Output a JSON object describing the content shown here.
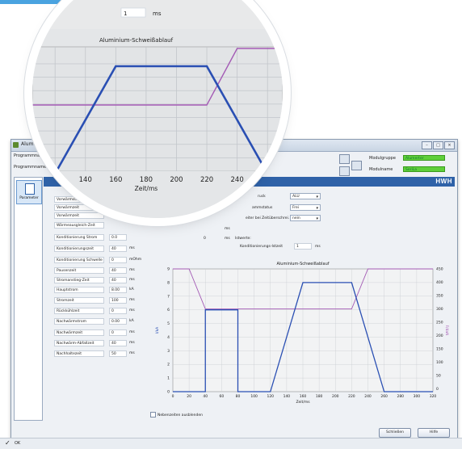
{
  "window": {
    "title": "Alumin",
    "row1_label": "Programmna",
    "row2_label": "Programmname",
    "modulgruppe_label": "Modulgruppe",
    "modulgruppe_value": "Alumerter",
    "modulname_label": "Modulname",
    "modulname_value": "SeriLa",
    "brand": "HWH"
  },
  "sidebar": {
    "items": [
      {
        "label": "Parameter"
      }
    ]
  },
  "params": [
    {
      "label": "Vorwärmstrom",
      "value": "",
      "unit": ""
    },
    {
      "label": "Vorwärmzeit",
      "value": "",
      "unit": ""
    },
    {
      "label": "Vorwärmzeit",
      "value": "",
      "unit": ""
    },
    {
      "label": "Wärmeausgleich-Zeit",
      "value": "",
      "unit": ""
    },
    {
      "label": "Konditionierung Strom",
      "value": "0.0",
      "unit": ""
    },
    {
      "label": "Konditionierungszeit",
      "value": "40",
      "unit": "ms"
    },
    {
      "label": "Konditionierung Schwelle",
      "value": "0",
      "unit": "mOhm"
    },
    {
      "label": "Pausenzeit",
      "value": "40",
      "unit": "ms"
    },
    {
      "label": "Stromanstieg-Zeit",
      "value": "40",
      "unit": "ms"
    },
    {
      "label": "Hauptstrom",
      "value": "8.00",
      "unit": "kA"
    },
    {
      "label": "Stromzeit",
      "value": "100",
      "unit": "ms"
    },
    {
      "label": "Rückkühlzeit",
      "value": "0",
      "unit": "ms"
    },
    {
      "label": "Nachwärmstrom",
      "value": "0.00",
      "unit": "kA"
    },
    {
      "label": "Nachwärmzeit",
      "value": "0",
      "unit": "ms"
    },
    {
      "label": "Nachwärm-Abfallzeit",
      "value": "40",
      "unit": "ms"
    },
    {
      "label": "Nachhaltezeit",
      "value": "50",
      "unit": "ms"
    }
  ],
  "right": {
    "dd1_label": "ruck",
    "dd1_value": "ALU",
    "dd2_label": "ammstatus",
    "dd2_value": "Frei",
    "dd3_label": "eiter bei Zeitüberschrei.",
    "dd3_value": "nein",
    "ms_value": "0",
    "ms_unit": "ms",
    "ms_unit2": "ms",
    "istwerte_label": "Istwerte:",
    "kond_label": "Konditionierungs-Istzeit",
    "kond_value": "1",
    "kond_unit": "ms"
  },
  "footer": {
    "checkbox_label": "Nebenzeiten ausblenden",
    "close_label": "Schließen",
    "help_label": "Hilfe",
    "status": "OK"
  },
  "magnifier": {
    "field_value": "1",
    "field_unit": "ms",
    "chart_title": "Aluminium-Schweißablauf"
  },
  "colors": {
    "current": "#2a4fb3",
    "force": "#a45bb5",
    "brand": "#2f62a8"
  },
  "chart_data": [
    {
      "type": "line",
      "title": "Aluminium-Schweißablauf",
      "xlabel": "Zeit/ms",
      "ylabel_left": "I/kA",
      "ylabel_right": "F/daN",
      "xlim": [
        0,
        320
      ],
      "ylim_left": [
        0,
        9
      ],
      "ylim_right": [
        -10,
        450
      ],
      "x_ticks": [
        0,
        20,
        40,
        60,
        80,
        100,
        120,
        140,
        160,
        180,
        200,
        220,
        240,
        260,
        280,
        300,
        320
      ],
      "y_left_ticks": [
        0,
        1,
        2,
        3,
        4,
        5,
        6,
        7,
        8,
        9
      ],
      "y_right_ticks": [
        0,
        50,
        100,
        150,
        200,
        250,
        300,
        350,
        400,
        450
      ],
      "grid": true,
      "series": [
        {
          "axis": "left",
          "x": [
            0,
            40,
            40,
            80,
            80,
            120,
            160,
            220,
            260,
            320
          ],
          "y": [
            0,
            0,
            6,
            6,
            0,
            0,
            8,
            8,
            0,
            0
          ]
        },
        {
          "axis": "right",
          "x": [
            0,
            20,
            40,
            220,
            240,
            320
          ],
          "y": [
            450,
            450,
            300,
            300,
            450,
            450
          ]
        }
      ]
    },
    {
      "type": "line",
      "title": "Aluminium-Schweißablauf",
      "xlabel": "Zeit/ms",
      "xlim": [
        105,
        270
      ],
      "x_ticks": [
        140,
        160,
        180,
        200,
        220,
        240,
        260
      ],
      "series": [
        {
          "x": [
            120,
            160,
            220,
            260
          ],
          "y": [
            0,
            8,
            8,
            0
          ]
        },
        {
          "x": [
            105,
            220,
            240,
            270
          ],
          "y": [
            300,
            300,
            450,
            450
          ]
        }
      ]
    }
  ]
}
